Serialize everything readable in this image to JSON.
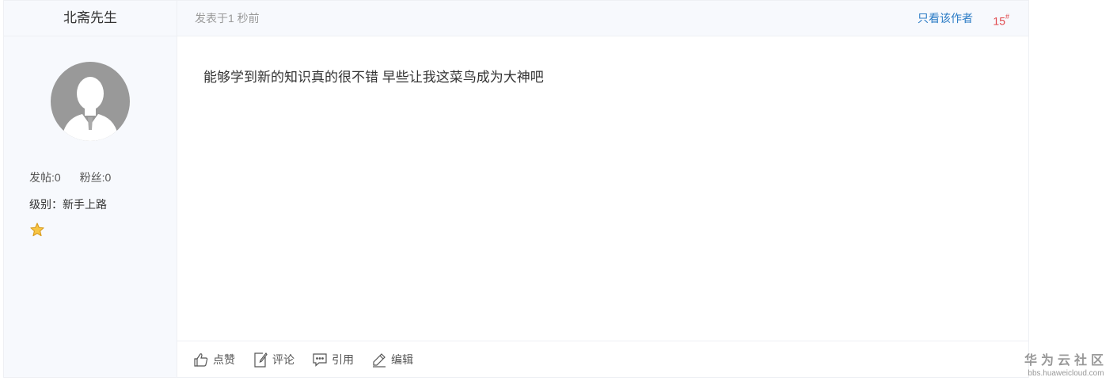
{
  "author": {
    "name": "北斋先生",
    "stats": {
      "posts": "发帖:0",
      "fans": "粉丝:0"
    },
    "level": "级别：新手上路"
  },
  "post": {
    "time": "发表于1 秒前",
    "only_author": "只看该作者",
    "floor": "15",
    "floor_mark": "#",
    "content": "能够学到新的知识真的很不错 早些让我这菜鸟成为大神吧"
  },
  "actions": [
    {
      "label": "点赞",
      "icon": "thumbs-up-icon"
    },
    {
      "label": "评论",
      "icon": "comment-edit-icon"
    },
    {
      "label": "引用",
      "icon": "quote-bubble-icon"
    },
    {
      "label": "编辑",
      "icon": "pen-icon"
    }
  ],
  "watermark": {
    "title": "华为云社区",
    "url": "bbs.huaweicloud.com"
  },
  "colors": {
    "link": "#2a7bc5",
    "floor": "#e0464a",
    "sidebar_bg": "#f7f9fd"
  }
}
